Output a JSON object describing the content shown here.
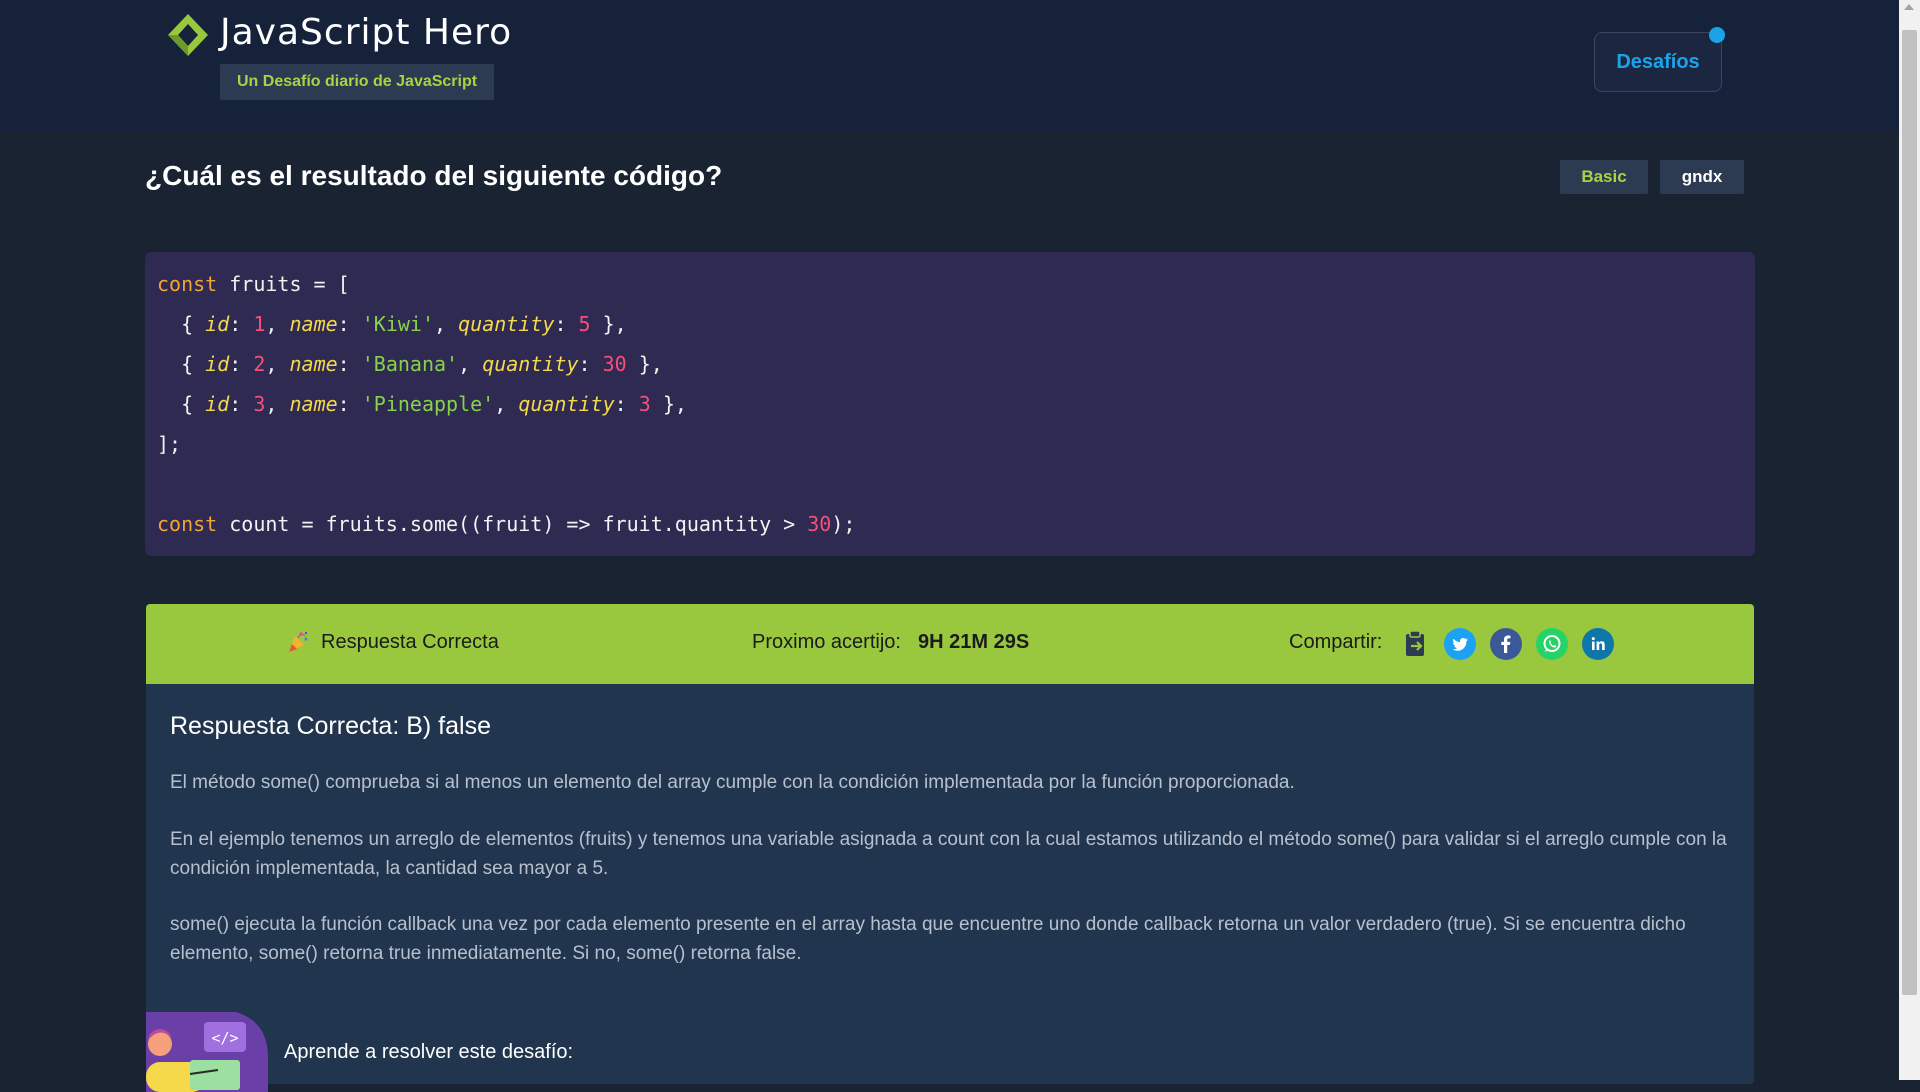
{
  "header": {
    "title": "JavaScript Hero",
    "subtitle": "Un Desafío diario de JavaScript",
    "challenges_button": "Desafíos"
  },
  "challenge": {
    "question": "¿Cuál es el resultado del siguiente código?",
    "level_tag": "Basic",
    "author_tag": "gndx"
  },
  "code": {
    "lines": [
      [
        [
          "kw",
          "const"
        ],
        [
          "plain",
          " fruits = ["
        ]
      ],
      [
        [
          "plain",
          "  { "
        ],
        [
          "prop",
          "id"
        ],
        [
          "plain",
          ": "
        ],
        [
          "num",
          "1"
        ],
        [
          "plain",
          ", "
        ],
        [
          "prop",
          "name"
        ],
        [
          "plain",
          ": "
        ],
        [
          "str",
          "'Kiwi'"
        ],
        [
          "plain",
          ", "
        ],
        [
          "prop",
          "quantity"
        ],
        [
          "plain",
          ": "
        ],
        [
          "num",
          "5"
        ],
        [
          "plain",
          " },"
        ]
      ],
      [
        [
          "plain",
          "  { "
        ],
        [
          "prop",
          "id"
        ],
        [
          "plain",
          ": "
        ],
        [
          "num",
          "2"
        ],
        [
          "plain",
          ", "
        ],
        [
          "prop",
          "name"
        ],
        [
          "plain",
          ": "
        ],
        [
          "str",
          "'Banana'"
        ],
        [
          "plain",
          ", "
        ],
        [
          "prop",
          "quantity"
        ],
        [
          "plain",
          ": "
        ],
        [
          "num",
          "30"
        ],
        [
          "plain",
          " },"
        ]
      ],
      [
        [
          "plain",
          "  { "
        ],
        [
          "prop",
          "id"
        ],
        [
          "plain",
          ": "
        ],
        [
          "num",
          "3"
        ],
        [
          "plain",
          ", "
        ],
        [
          "prop",
          "name"
        ],
        [
          "plain",
          ": "
        ],
        [
          "str",
          "'Pineapple'"
        ],
        [
          "plain",
          ", "
        ],
        [
          "prop",
          "quantity"
        ],
        [
          "plain",
          ": "
        ],
        [
          "num",
          "3"
        ],
        [
          "plain",
          " },"
        ]
      ],
      [
        [
          "plain",
          "];"
        ]
      ],
      [],
      [
        [
          "kw",
          "const"
        ],
        [
          "plain",
          " count = fruits.some((fruit) => fruit.quantity > "
        ],
        [
          "num",
          "30"
        ],
        [
          "plain",
          ");"
        ]
      ]
    ]
  },
  "result": {
    "status": "Respuesta Correcta",
    "next_label": "Proximo acertijo:",
    "next_time": "9H 21M 29S",
    "share_label": "Compartir:",
    "share_icons": [
      "clipboard-icon",
      "twitter-icon",
      "facebook-icon",
      "whatsapp-icon",
      "linkedin-icon"
    ]
  },
  "explanation": {
    "title": "Respuesta Correcta: B) false",
    "paragraphs": [
      "El método some() comprueba si al menos un elemento del array cumple con la condición implementada por la función proporcionada.",
      "En el ejemplo tenemos un arreglo de elementos (fruits) y tenemos una variable asignada a count con la cual estamos utilizando el método some() para validar si el arreglo cumple con la condición implementada, la cantidad sea mayor a 5.",
      "some() ejecuta la función callback una vez por cada elemento presente en el array hasta que encuentre uno donde callback retorna un valor verdadero (true). Si se encuentra dicho elemento, some() retorna true inmediatamente. Si no, some() retorna false."
    ],
    "learn_label": "Aprende a resolver este desafío:"
  },
  "colors": {
    "accent_green": "#99c83f",
    "accent_blue": "#1aa3e8",
    "background": "#1a2332",
    "code_background": "#2e2a52"
  }
}
